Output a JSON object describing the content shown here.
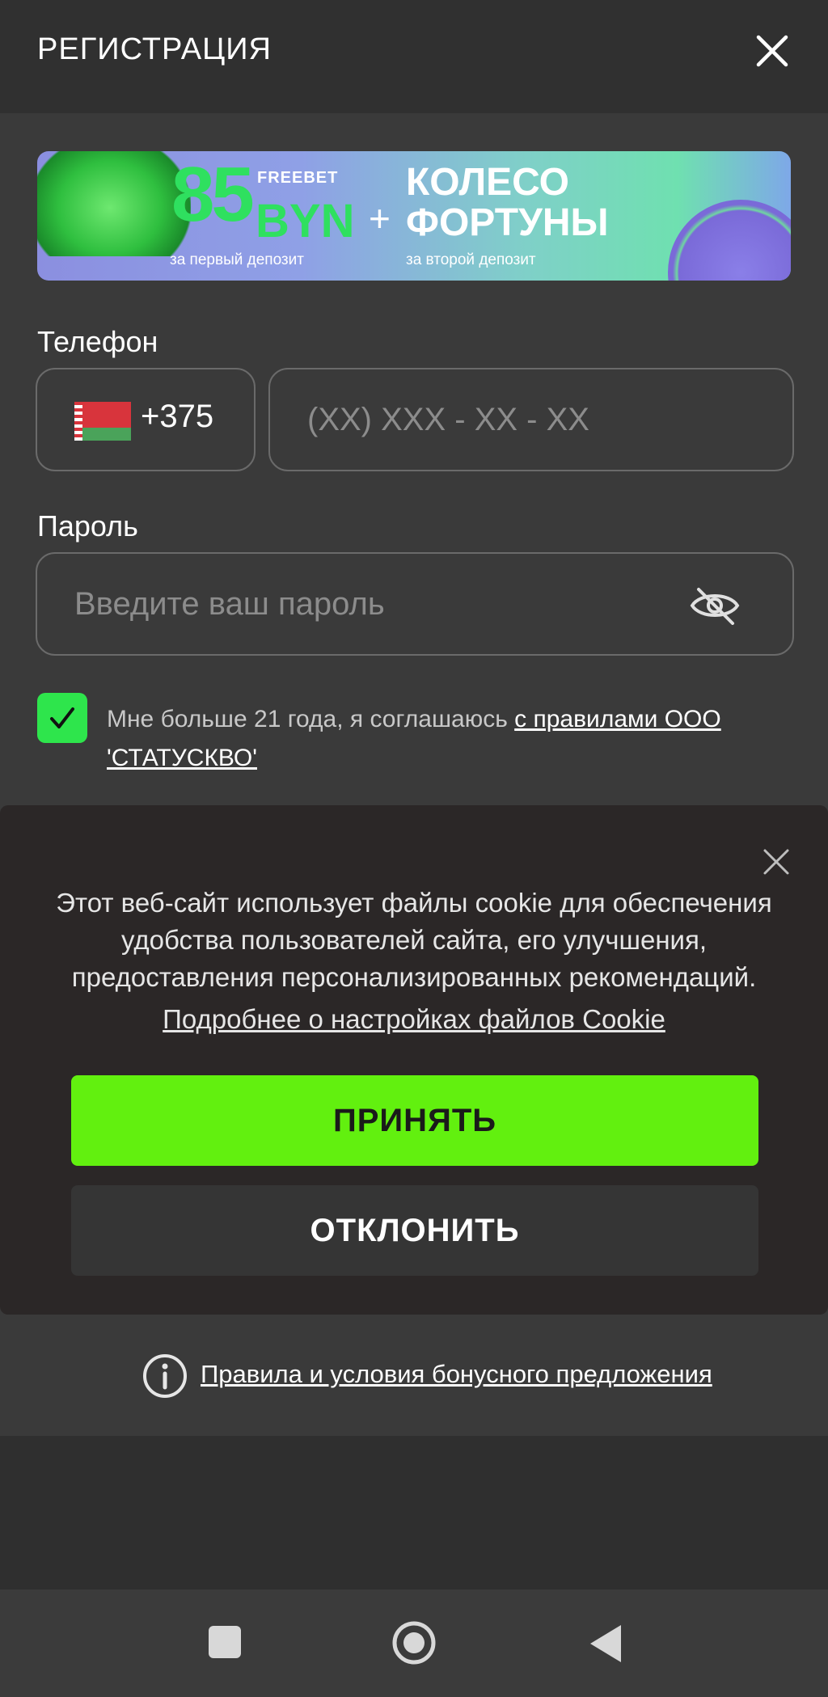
{
  "header": {
    "title": "РЕГИСТРАЦИЯ",
    "close_icon": "close-icon"
  },
  "banner": {
    "amount": "85",
    "currency": "BYN",
    "freebet": "FREEBET",
    "plus": "+",
    "wheel_line1": "КОЛЕСО",
    "wheel_line2": "ФОРТУНЫ",
    "sub_first": "за первый депозит",
    "sub_second": "за второй депозит"
  },
  "form": {
    "phone_label": "Телефон",
    "country_code": "+375",
    "country_flag": "belarus-flag-icon",
    "phone_placeholder": "(XX) XXX - XX - XX",
    "password_label": "Пароль",
    "password_placeholder": "Введите ваш пароль",
    "eye_icon": "eye-off-icon",
    "agree_checked": true,
    "agree_text": "Мне больше 21 года, я соглашаюсь ",
    "agree_link": "с правилами ООО 'СТАТУСКВО'"
  },
  "cookie": {
    "text": "Этот веб-сайт использует файлы cookie для обеспечения удобства пользователей сайта, его улучшения, предоставления персонализированных рекомендаций.",
    "link": "Подробнее о настройках файлов Cookie",
    "accept": "ПРИНЯТЬ",
    "decline": "ОТКЛОНИТЬ"
  },
  "footer": {
    "rules_link": "Правила и условия бонусного предложения"
  },
  "colors": {
    "accent": "#62f00f",
    "checkbox": "#2ee54c",
    "background": "#3a3a3a"
  }
}
